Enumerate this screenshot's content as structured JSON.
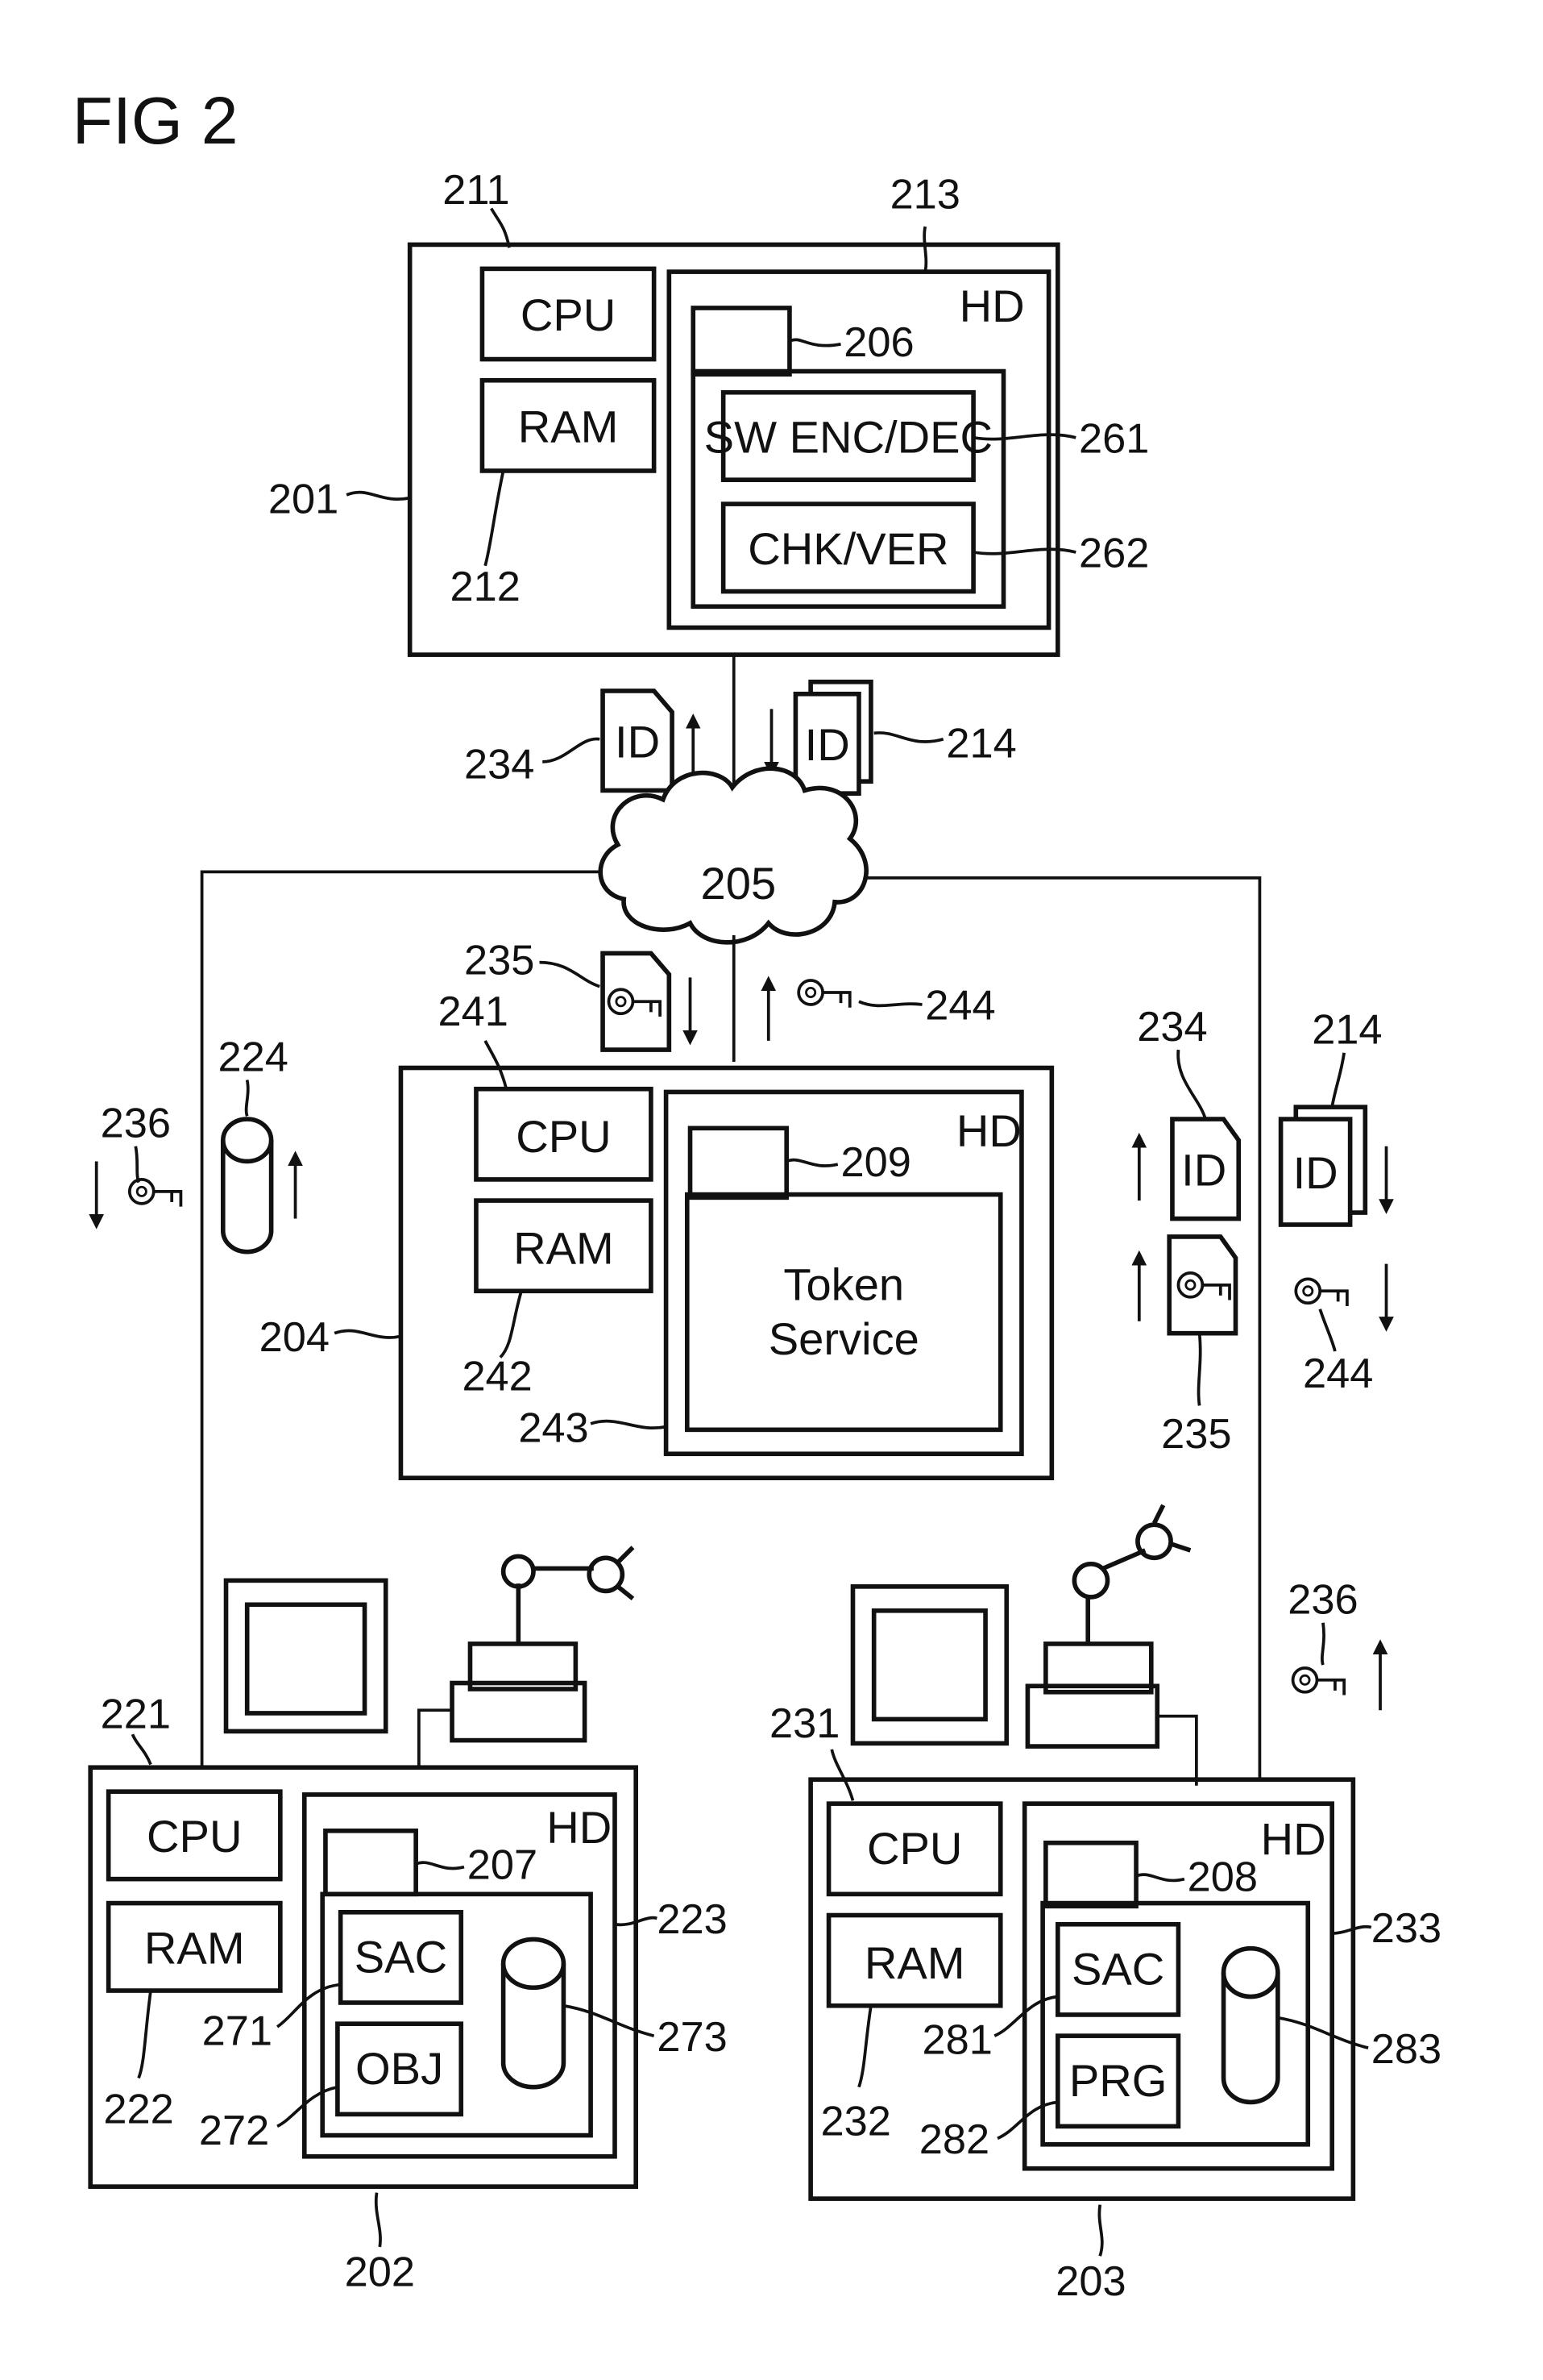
{
  "figure": {
    "title": "FIG 2"
  },
  "server_201": {
    "ref": "201",
    "cpu": {
      "label": "CPU",
      "ref": "211"
    },
    "ram": {
      "label": "RAM",
      "ref": "212"
    },
    "hd": {
      "label": "HD",
      "ref": "213",
      "program_ref": "206"
    },
    "sw_encdec": {
      "label": "SW ENC/DEC",
      "ref": "261"
    },
    "chk_ver": {
      "label": "CHK/VER",
      "ref": "262"
    }
  },
  "transfer_top": {
    "id_single": {
      "label": "ID",
      "ref": "234"
    },
    "id_stack": {
      "label": "ID",
      "ref": "214"
    }
  },
  "network": {
    "ref": "205"
  },
  "transfer_mid": {
    "key_doc": {
      "ref": "235"
    },
    "key": {
      "ref": "244"
    }
  },
  "left_side": {
    "key": {
      "ref": "236"
    },
    "cylinder": {
      "ref": "224"
    }
  },
  "token_server_204": {
    "ref": "204",
    "cpu": {
      "label": "CPU",
      "ref": "241"
    },
    "ram": {
      "label": "RAM",
      "ref": "242"
    },
    "hd": {
      "label": "HD",
      "ref": "243",
      "program_ref": "209"
    },
    "service": {
      "line1": "Token",
      "line2": "Service"
    }
  },
  "right_side": {
    "id_single": {
      "label": "ID",
      "ref": "234"
    },
    "id_stack": {
      "label": "ID",
      "ref": "214"
    },
    "key_doc": {
      "ref": "235"
    },
    "key": {
      "ref": "244"
    },
    "key_lower": {
      "ref": "236"
    }
  },
  "client_202": {
    "ref": "202",
    "cpu": {
      "label": "CPU",
      "ref": "221"
    },
    "ram": {
      "label": "RAM",
      "ref": "222"
    },
    "hd": {
      "label": "HD",
      "ref": "223",
      "program_ref": "207"
    },
    "sac": {
      "label": "SAC",
      "ref": "271"
    },
    "obj": {
      "label": "OBJ",
      "ref": "272"
    },
    "db": {
      "ref": "273"
    }
  },
  "client_203": {
    "ref": "203",
    "cpu": {
      "label": "CPU",
      "ref": "231"
    },
    "ram": {
      "label": "RAM",
      "ref": "232"
    },
    "hd": {
      "label": "HD",
      "ref": "233",
      "program_ref": "208"
    },
    "sac": {
      "label": "SAC",
      "ref": "281"
    },
    "prg": {
      "label": "PRG",
      "ref": "282"
    },
    "db": {
      "ref": "283"
    }
  }
}
